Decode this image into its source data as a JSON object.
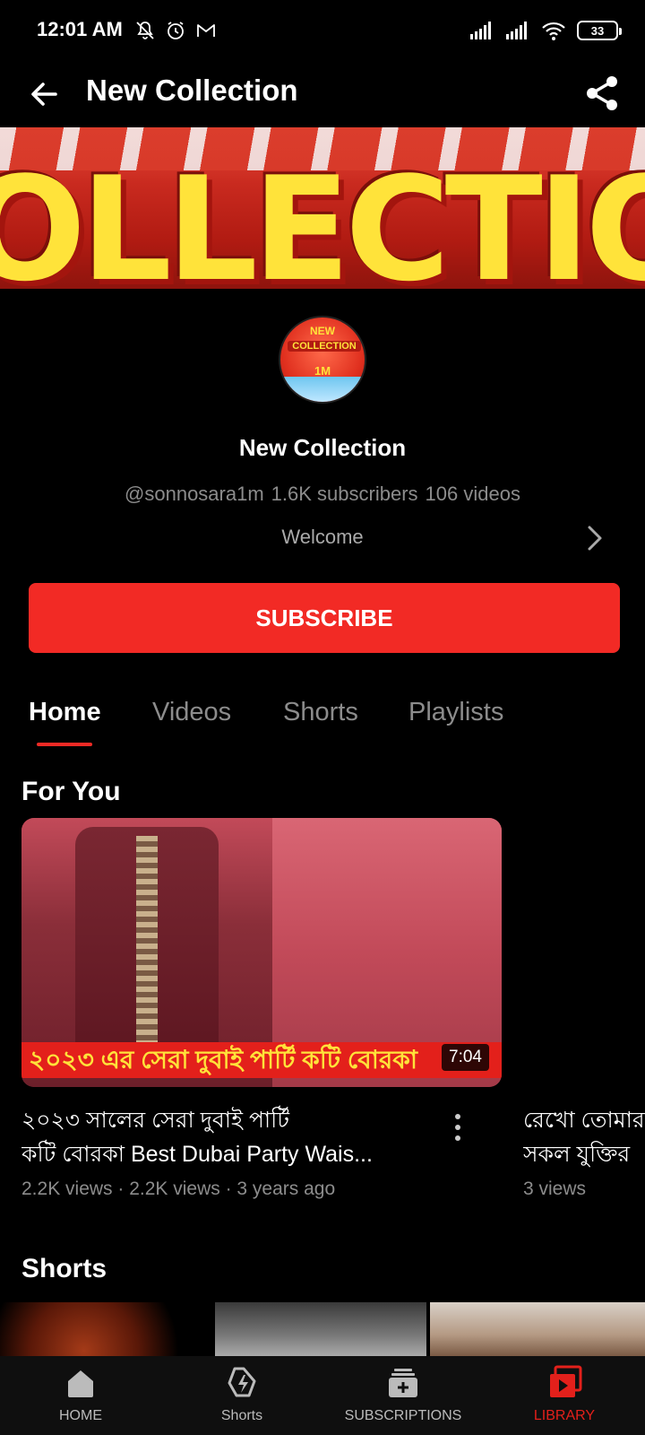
{
  "status_bar": {
    "time": "12:01 AM",
    "battery": "33"
  },
  "header": {
    "title": "New Collection"
  },
  "banner": {
    "text": "OLLECTIO"
  },
  "avatar": {
    "line1": "NEW",
    "line2": "COLLECTION",
    "line3": "1M"
  },
  "channel": {
    "name": "New Collection",
    "handle": "@sonnosara1m",
    "subscribers": "1.6K subscribers",
    "videos": "106 videos",
    "description": "Welcome",
    "subscribe_label": "SUBSCRIBE"
  },
  "tabs": [
    {
      "label": "Home",
      "active": true
    },
    {
      "label": "Videos",
      "active": false
    },
    {
      "label": "Shorts",
      "active": false
    },
    {
      "label": "Playlists",
      "active": false
    }
  ],
  "for_you": {
    "title": "For You",
    "videos": [
      {
        "thumbnail_caption": "২০২৩ এর সেরা দুবাই পার্টি কটি বোরকা",
        "duration": "7:04",
        "title_line1": "২০২৩ সালের সেরা দুবাই পার্টি",
        "title_line2": "কটি বোরকা Best Dubai Party Wais...",
        "meta": "2.2K views · 2.2K views · 3 years ago"
      },
      {
        "title_line1": "রেখো তোমার",
        "title_line2": "সকল যুক্তির",
        "meta": "3 views"
      }
    ]
  },
  "shorts": {
    "title": "Shorts"
  },
  "bottom_nav": {
    "home": "HOME",
    "shorts": "Shorts",
    "subscriptions": "SUBSCRIPTIONS",
    "library": "LIBRARY"
  },
  "colors": {
    "accent": "#f22a25",
    "background": "#000000",
    "muted_text": "#8c8c8c",
    "library_active": "#e3201b"
  }
}
